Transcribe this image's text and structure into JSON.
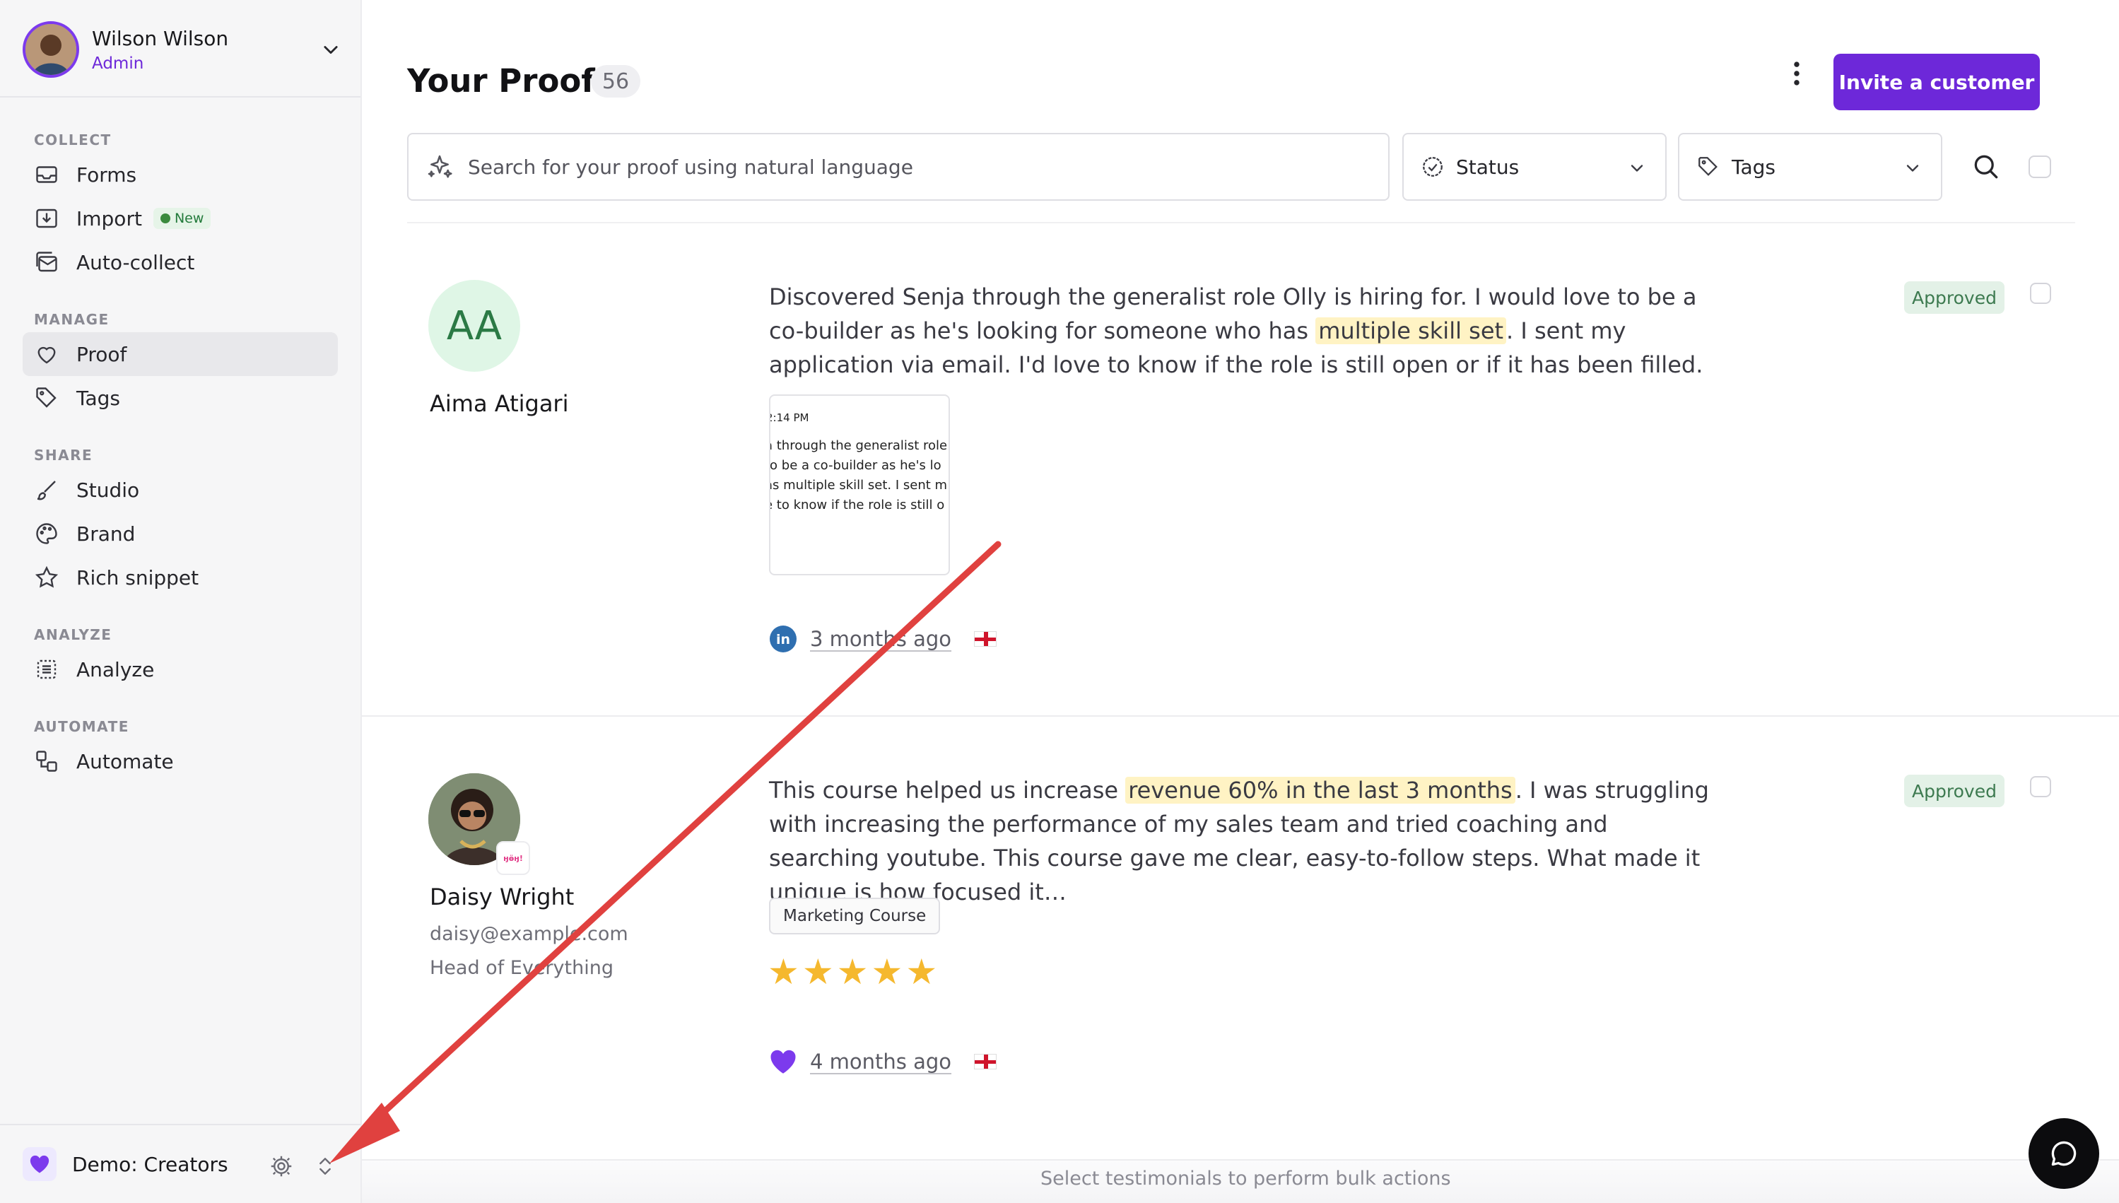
{
  "user": {
    "name": "Wilson Wilson",
    "role": "Admin"
  },
  "sidebar": {
    "sections": [
      {
        "title": "COLLECT",
        "items": [
          {
            "label": "Forms",
            "icon": "inbox-icon"
          },
          {
            "label": "Import",
            "icon": "import-icon",
            "badge": "New"
          },
          {
            "label": "Auto-collect",
            "icon": "mail-stack-icon"
          }
        ]
      },
      {
        "title": "MANAGE",
        "items": [
          {
            "label": "Proof",
            "icon": "heart-icon",
            "active": true
          },
          {
            "label": "Tags",
            "icon": "tag-icon"
          }
        ]
      },
      {
        "title": "SHARE",
        "items": [
          {
            "label": "Studio",
            "icon": "brush-icon"
          },
          {
            "label": "Brand",
            "icon": "palette-icon"
          },
          {
            "label": "Rich snippet",
            "icon": "star-icon"
          }
        ]
      },
      {
        "title": "ANALYZE",
        "items": [
          {
            "label": "Analyze",
            "icon": "analyze-icon"
          }
        ]
      },
      {
        "title": "AUTOMATE",
        "items": [
          {
            "label": "Automate",
            "icon": "automate-icon"
          }
        ]
      }
    ]
  },
  "workspace": {
    "name": "Demo: Creators"
  },
  "header": {
    "title": "Your Proof",
    "count": "56",
    "invite_label": "Invite a customer"
  },
  "filters": {
    "search_placeholder": "Search for your proof using natural language",
    "status_label": "Status",
    "tags_label": "Tags"
  },
  "testimonials": [
    {
      "initials": "AA",
      "name": "Aima Atigari",
      "text_before": "Discovered Senja through the generalist role Olly is hiring for. I would love to be a co-builder as he's looking for someone who has ",
      "highlight": "multiple skill set",
      "text_after": ". I sent my application via email. I'd love to know if the role is still open or if it has been filled.",
      "status": "Approved",
      "time": "3 months ago",
      "source": "linkedin-icon",
      "attachment_lines": [
        "2:14 PM",
        "a through the generalist role",
        "to be a co-builder as he's lo",
        "as multiple skill set. I sent m",
        "e to know if the role is still o"
      ]
    },
    {
      "name": "Daisy Wright",
      "email": "daisy@example.com",
      "title": "Head of Everything",
      "logo_text": "ӈӫӈ!",
      "text_before": "This course helped us increase ",
      "highlight": "revenue 60% in the last 3 months",
      "text_after": ". I was struggling with increasing the performance of my sales team and tried coaching and searching youtube. This course gave me clear, easy-to-follow steps. What made it unique is how focused it…",
      "status": "Approved",
      "tag": "Marketing Course",
      "rating": 5,
      "time": "4 months ago",
      "source": "heart-source-icon"
    }
  ],
  "bulk": {
    "hint": "Select testimonials to perform bulk actions"
  },
  "colors": {
    "accent": "#6d28d9",
    "approved_bg": "#e3f1e7",
    "highlight": "#fff3c4",
    "arrow": "#e0413f"
  }
}
